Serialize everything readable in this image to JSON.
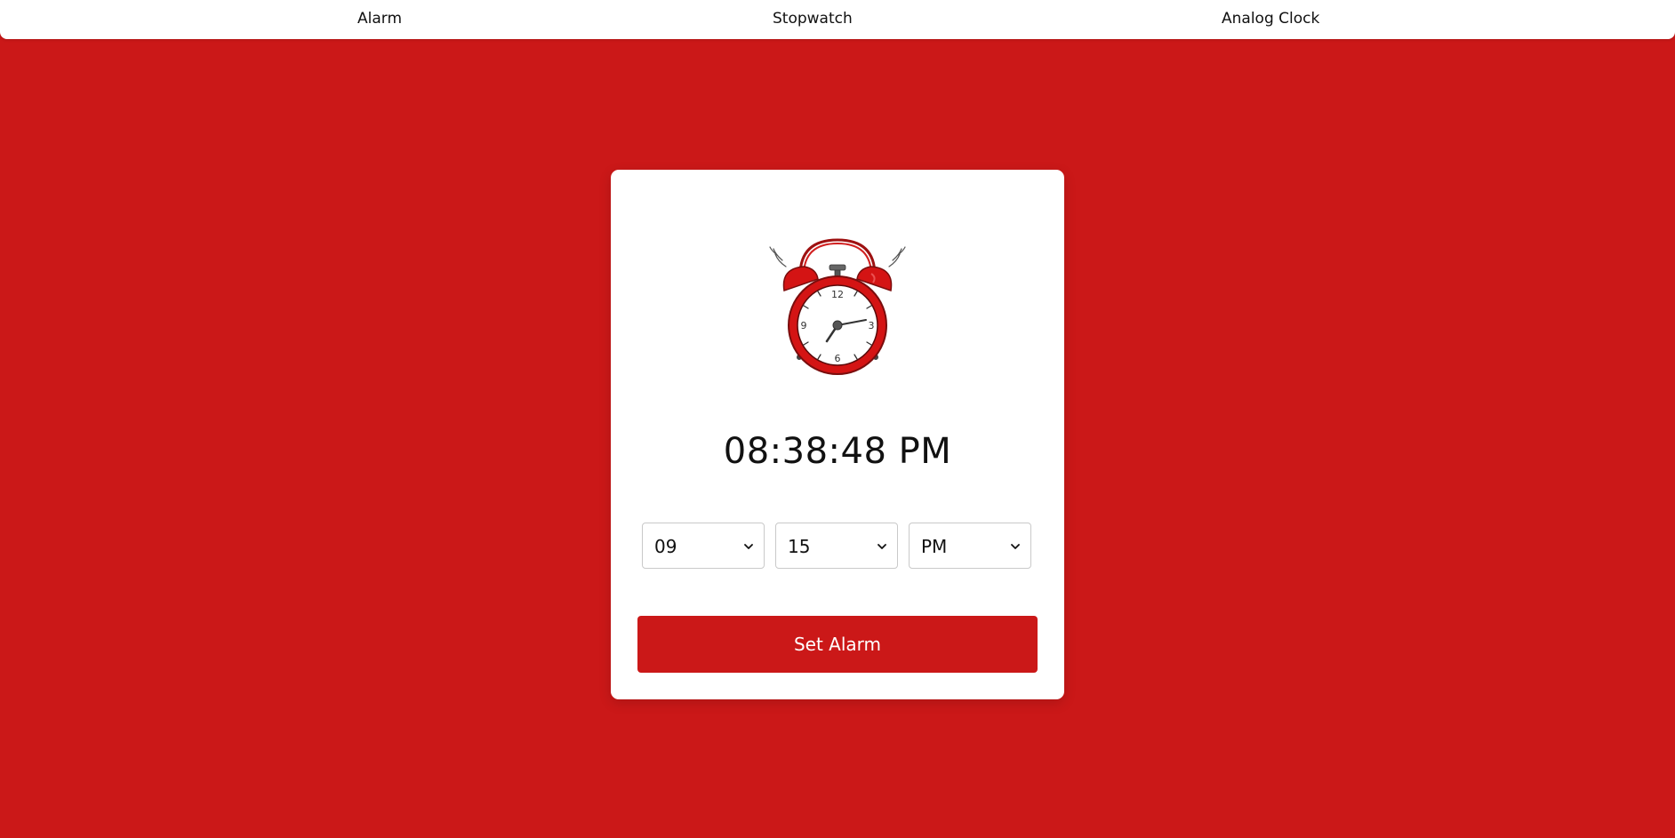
{
  "nav": {
    "alarm": "Alarm",
    "stopwatch": "Stopwatch",
    "analog_clock": "Analog Clock"
  },
  "clock_icon": {
    "name": "alarm-clock-icon",
    "numerals": [
      "12",
      "3",
      "6",
      "9"
    ]
  },
  "current_time": "08:38:48 PM",
  "alarm_form": {
    "hour": "09",
    "minute": "15",
    "ampm": "PM",
    "submit_label": "Set Alarm"
  },
  "colors": {
    "accent": "#cb1818",
    "card": "#ffffff",
    "text": "#111111"
  }
}
